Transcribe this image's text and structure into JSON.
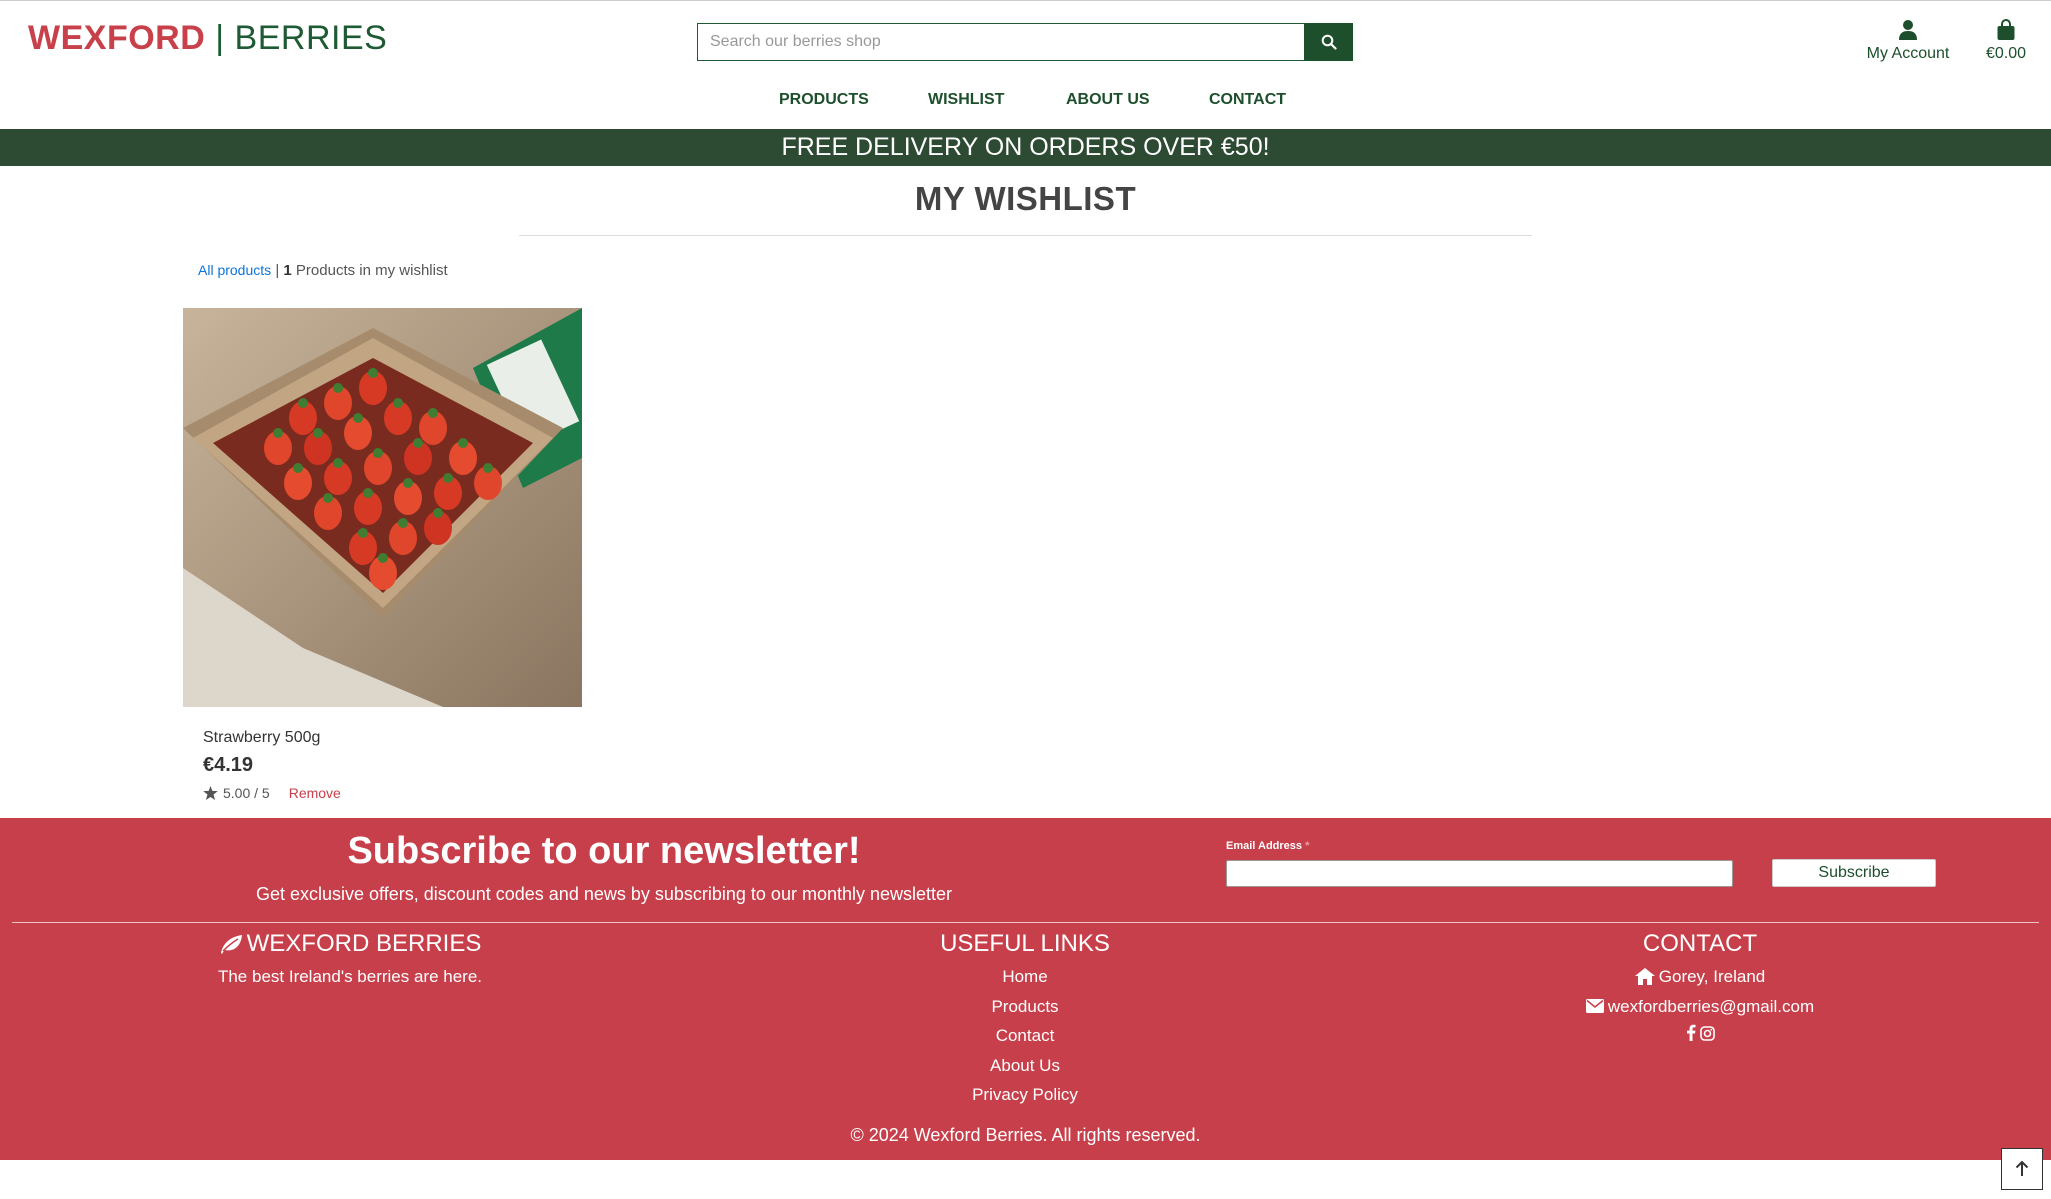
{
  "header": {
    "brand_part1": "WEXFORD",
    "brand_sep": "|",
    "brand_part2": "BERRIES",
    "search_placeholder": "Search our berries shop",
    "search_icon": "search-icon",
    "account_label": "My Account",
    "account_icon": "user-icon",
    "cart_total": "€0.00",
    "cart_icon": "shopping-bag-icon"
  },
  "nav": {
    "items": [
      "PRODUCTS",
      "WISHLIST",
      "ABOUT US",
      "CONTACT"
    ]
  },
  "banner": {
    "text": "FREE DELIVERY ON ORDERS OVER €50!"
  },
  "main": {
    "title": "MY WISHLIST",
    "breadcrumb_link": "All products",
    "breadcrumb_sep": "|",
    "count": "1",
    "count_suffix": "Products in my wishlist"
  },
  "product": {
    "name": "Strawberry 500g",
    "price": "€4.19",
    "rating": "5.00 / 5",
    "remove_label": "Remove",
    "rating_icon": "star-icon"
  },
  "footer": {
    "newsletter_title": "Subscribe to our newsletter!",
    "newsletter_sub": "Get exclusive offers, discount codes and news by subscribing to our monthly newsletter",
    "email_label": "Email Address",
    "email_required": "*",
    "subscribe_label": "Subscribe",
    "brand_title": "WEXFORD BERRIES",
    "brand_icon": "leaf-icon",
    "brand_tagline": "The best Ireland's berries are here.",
    "links_title": "USEFUL LINKS",
    "links": [
      "Home",
      "Products",
      "Contact",
      "About Us",
      "Privacy Policy"
    ],
    "contact_title": "CONTACT",
    "contact_location": "Gorey, Ireland",
    "contact_email": "wexfordberries@gmail.com",
    "social_icons": [
      "facebook-icon",
      "instagram-icon"
    ],
    "copyright": "© 2024 Wexford Berries. All rights reserved."
  },
  "colors": {
    "brand_red": "#c8404a",
    "brand_green": "#1e5a33",
    "banner_green": "#2d4a33",
    "footer_red": "#c73f4a",
    "link_blue": "#0b74d8"
  }
}
